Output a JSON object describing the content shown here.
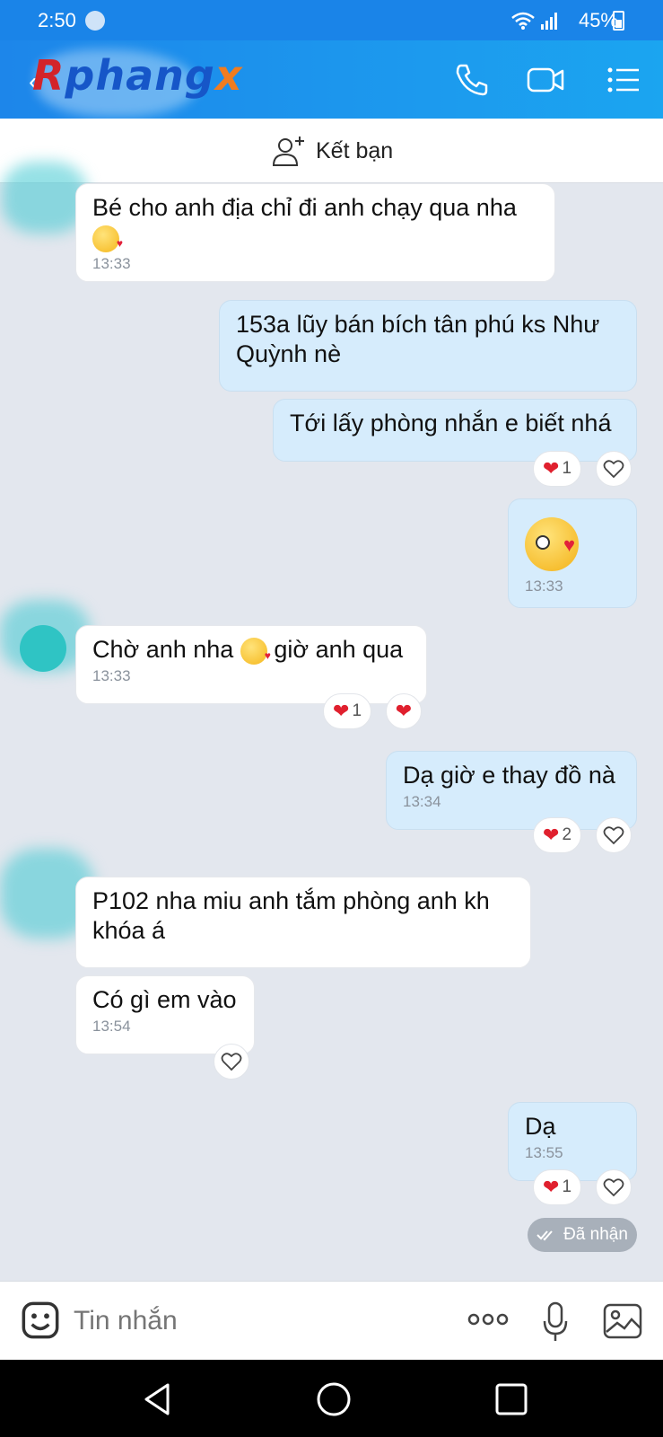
{
  "status": {
    "time": "2:50",
    "battery": "45%"
  },
  "header": {
    "logo_part1": "R",
    "logo_part2": "phang",
    "logo_part3": "x"
  },
  "friend_bar": {
    "label": "Kết bạn"
  },
  "messages": [
    {
      "text": "Bé cho anh địa chỉ đi anh chạy qua nha",
      "time": "13:33",
      "emoji": "kiss"
    },
    {
      "line1": "153a lũy bán bích tân phú ks Như",
      "line2": "Quỳnh nè"
    },
    {
      "text": "Tới lấy phòng nhắn e biết nhá",
      "reaction_count": "1"
    },
    {
      "emoji": "kiss",
      "time": "13:33"
    },
    {
      "text_before": "Chờ anh nha",
      "text_after": "giờ anh qua",
      "time": "13:33",
      "reaction_count": "1"
    },
    {
      "text": "Dạ giờ e thay đồ nà",
      "time": "13:34",
      "reaction_count": "2"
    },
    {
      "line1": "P102 nha miu anh tắm phòng anh kh",
      "line2": "khóa á"
    },
    {
      "text": "Có gì em vào",
      "time": "13:54"
    },
    {
      "text": "Dạ",
      "time": "13:55",
      "reaction_count": "1"
    }
  ],
  "received_label": "Đã nhận",
  "input": {
    "placeholder": "Tin nhắn"
  },
  "colors": {
    "header": "#1d86ea",
    "outgoing": "#d6ecfc",
    "incoming": "#ffffff",
    "background": "#e3e7ee",
    "heart": "#e0202e"
  }
}
